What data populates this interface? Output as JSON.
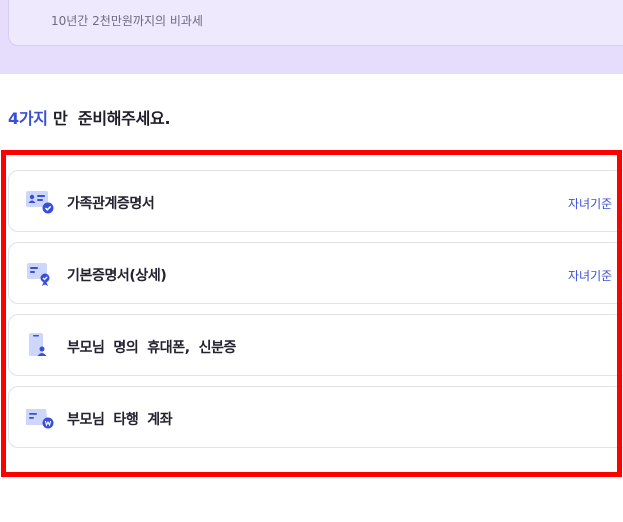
{
  "top_card": {
    "subtitle": "10년간 2천만원까지의 비과세"
  },
  "section": {
    "count_accent": "4가지",
    "title_rest": " 만  준비해주세요."
  },
  "documents": [
    {
      "label": "가족관계증명서",
      "tag": "자녀기준",
      "icon": "family-id-card-icon"
    },
    {
      "label": "기본증명서(상세)",
      "tag": "자녀기준",
      "icon": "certificate-badge-icon"
    },
    {
      "label": "부모님  명의  휴대폰,  신분증",
      "tag": "",
      "icon": "phone-id-icon"
    },
    {
      "label": "부모님  타행  계좌",
      "tag": "",
      "icon": "bank-account-icon"
    }
  ],
  "colors": {
    "accent": "#3a4fd8",
    "highlight": "#ff0000",
    "band": "#e6dcfb"
  }
}
